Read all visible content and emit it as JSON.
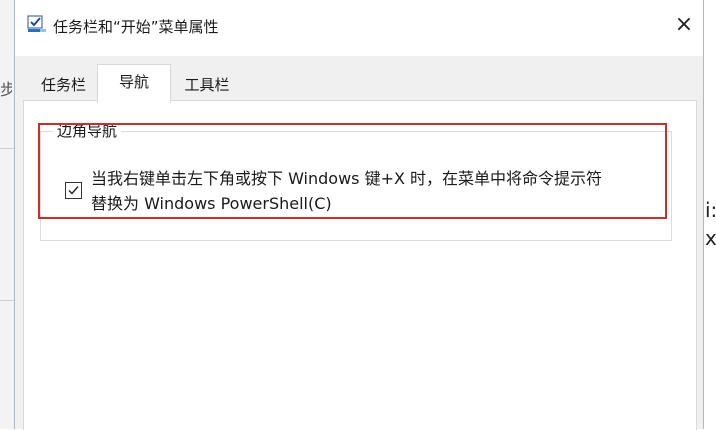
{
  "background": {
    "left_glyph": "步",
    "right_text_line1": "i:",
    "right_text_line2": "x"
  },
  "dialog": {
    "title": "任务栏和“开始”菜单属性",
    "close_label": "×",
    "tabs": [
      {
        "label": "任务栏",
        "active": false
      },
      {
        "label": "导航",
        "active": true
      },
      {
        "label": "工具栏",
        "active": false
      }
    ],
    "group": {
      "title": "边角导航",
      "checkbox": {
        "checked": true,
        "label_line1": "当我右键单击左下角或按下 Windows 键+X 时，在菜单中将命令提示符",
        "label_line2": "替换为 Windows PowerShell(C)"
      }
    }
  },
  "colors": {
    "highlight": "#c9302c",
    "dialog_bg": "#f0f0f0"
  }
}
